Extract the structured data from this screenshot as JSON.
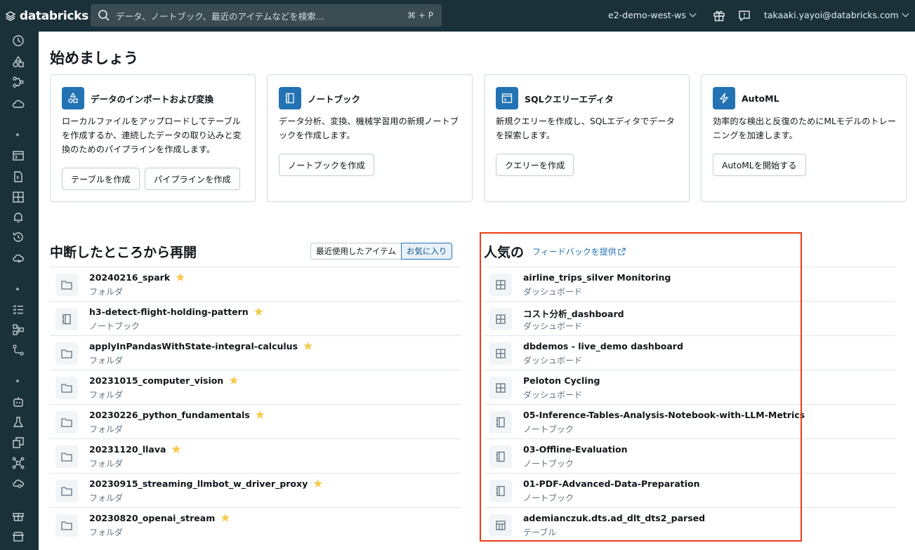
{
  "topbar": {
    "logo_text": "databricks",
    "search_placeholder": "データ、ノートブック、最近のアイテムなどを検索...",
    "search_shortcut": "⌘ + P",
    "workspace": "e2-demo-west-ws",
    "user": "takaaki.yayoi@databricks.com"
  },
  "page": {
    "title": "始めましょう"
  },
  "cards": [
    {
      "title": "データのインポートおよび変換",
      "description": "ローカルファイルをアップロードしてテーブルを作成するか、連続したデータの取り込みと変換のためのパイプラインを作成します。",
      "buttons": [
        "テーブルを作成",
        "パイプラインを作成"
      ]
    },
    {
      "title": "ノートブック",
      "description": "データ分析、変換、機械学習用の新規ノートブックを作成します。",
      "buttons": [
        "ノートブックを作成"
      ]
    },
    {
      "title": "SQLクエリーエディタ",
      "description": "新規クエリーを作成し、SQLエディタでデータを探索します。",
      "buttons": [
        "クエリーを作成"
      ]
    },
    {
      "title": "AutoML",
      "description": "効率的な検出と反復のためにMLモデルのトレーニングを加速します。",
      "buttons": [
        "AutoMLを開始する"
      ]
    }
  ],
  "resume": {
    "title": "中断したところから再開",
    "tab_recent": "最近使用したアイテム",
    "tab_favorites": "お気に入り",
    "items": [
      {
        "name": "20240216_spark",
        "type": "フォルダ",
        "icon": "folder-icon"
      },
      {
        "name": "h3-detect-flight-holding-pattern",
        "type": "ノートブック",
        "icon": "notebook-icon"
      },
      {
        "name": "applyInPandasWithState-integral-calculus",
        "type": "フォルダ",
        "icon": "folder-icon"
      },
      {
        "name": "20231015_computer_vision",
        "type": "フォルダ",
        "icon": "folder-icon"
      },
      {
        "name": "20230226_python_fundamentals",
        "type": "フォルダ",
        "icon": "folder-icon"
      },
      {
        "name": "20231120_llava",
        "type": "フォルダ",
        "icon": "folder-icon"
      },
      {
        "name": "20230915_streaming_llmbot_w_driver_proxy",
        "type": "フォルダ",
        "icon": "folder-icon"
      },
      {
        "name": "20230820_openai_stream",
        "type": "フォルダ",
        "icon": "folder-icon"
      }
    ]
  },
  "popular": {
    "title": "人気の",
    "feedback": "フィードバックを提供",
    "items": [
      {
        "name": "airline_trips_silver Monitoring",
        "type": "ダッシュボード",
        "icon": "dashboard-icon"
      },
      {
        "name": "コスト分析_dashboard",
        "type": "ダッシュボード",
        "icon": "dashboard-icon"
      },
      {
        "name": "dbdemos - live_demo dashboard",
        "type": "ダッシュボード",
        "icon": "dashboard-icon"
      },
      {
        "name": "Peloton Cycling",
        "type": "ダッシュボード",
        "icon": "dashboard-icon"
      },
      {
        "name": "05-Inference-Tables-Analysis-Notebook-with-LLM-Metrics",
        "type": "ノートブック",
        "icon": "notebook-icon"
      },
      {
        "name": "03-Offline-Evaluation",
        "type": "ノートブック",
        "icon": "notebook-icon"
      },
      {
        "name": "01-PDF-Advanced-Data-Preparation",
        "type": "ノートブック",
        "icon": "notebook-icon"
      },
      {
        "name": "ademianczuk.dts.ad_dlt_dts2_parsed",
        "type": "テーブル",
        "icon": "table-icon"
      }
    ]
  },
  "colors": {
    "topbar": "#1b3139",
    "accent": "#2272b4",
    "highlight": "#ec3b15",
    "star": "#f7c948"
  }
}
